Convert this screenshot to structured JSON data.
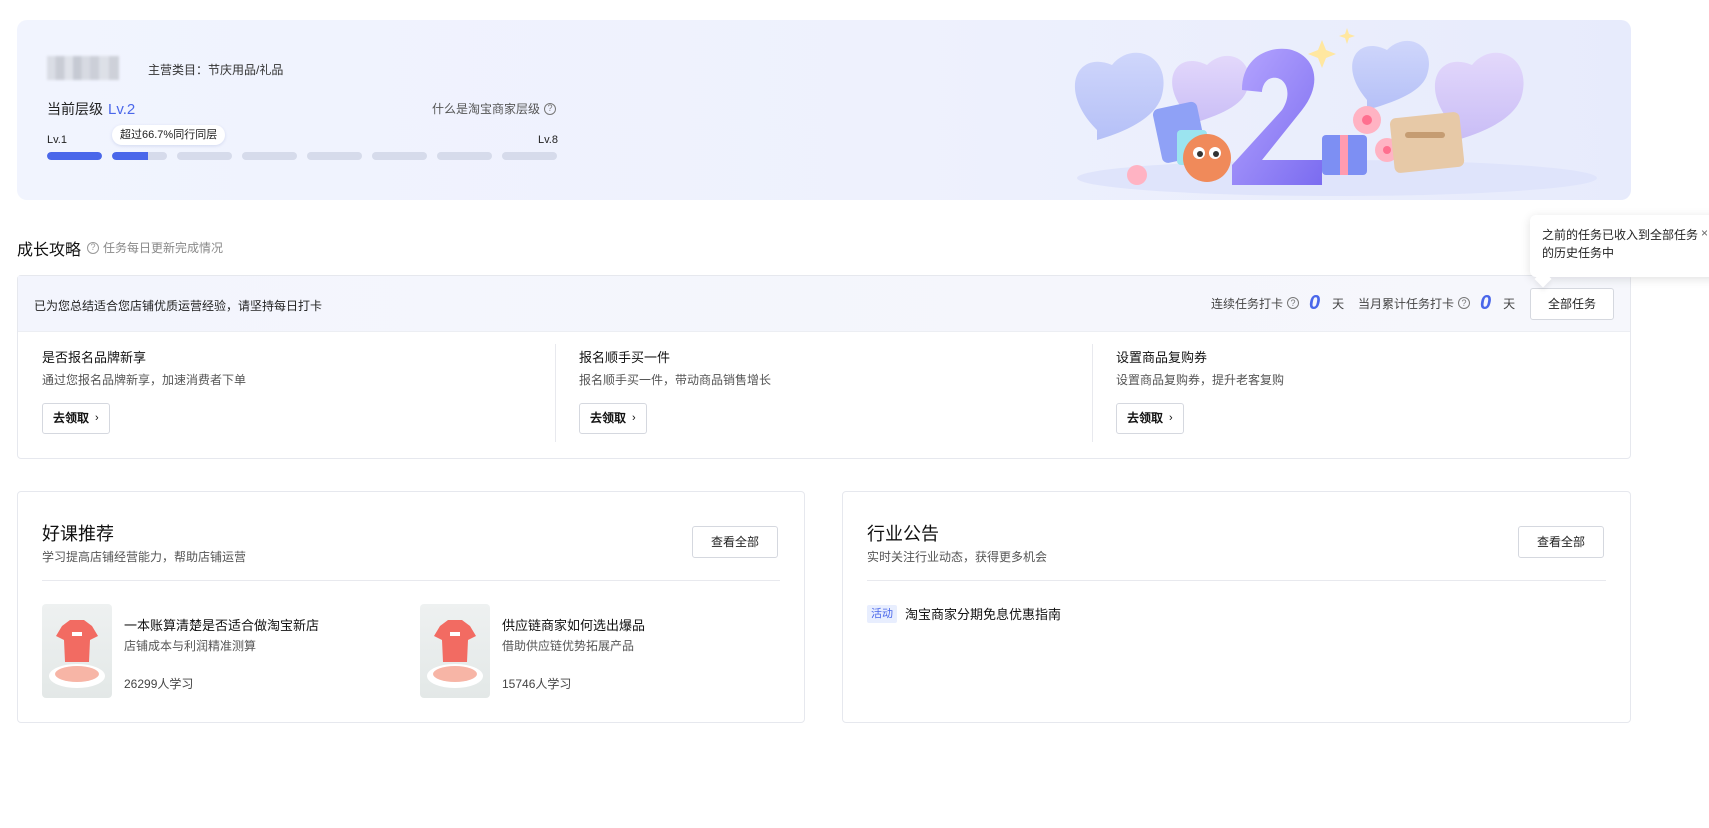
{
  "level": {
    "category": "主营类目：节庆用品/礼品",
    "current_label": "当前层级",
    "current_value": "Lv.2",
    "what_is_level": "什么是淘宝商家层级",
    "min_level": "Lv.1",
    "max_level": "Lv.8",
    "exceed_text": "超过66.7%同行同层",
    "progress": [
      1,
      0.65,
      0,
      0,
      0,
      0,
      0,
      0
    ]
  },
  "growth": {
    "title": "成长攻略",
    "subtitle": "任务每日更新完成情况",
    "tooltip": "之前的任务已收入到全部任务的历史任务中",
    "tooltip_close": "×",
    "header_text": "已为您总结适合您店铺优质运营经验，请坚持每日打卡",
    "streak_label": "连续任务打卡",
    "streak_value": "0",
    "month_label": "当月累计任务打卡",
    "month_value": "0",
    "unit": "天",
    "all_tasks_label": "全部任务",
    "tasks": [
      {
        "title": "是否报名品牌新享",
        "desc": "通过您报名品牌新享，加速消费者下单",
        "button": "去领取"
      },
      {
        "title": "报名顺手买一件",
        "desc": "报名顺手买一件，带动商品销售增长",
        "button": "去领取"
      },
      {
        "title": "设置商品复购券",
        "desc": "设置商品复购券，提升老客复购",
        "button": "去领取"
      }
    ]
  },
  "courses": {
    "title": "好课推荐",
    "subtitle": "学习提高店铺经营能力，帮助店铺运营",
    "view_all": "查看全部",
    "items": [
      {
        "title": "一本账算清楚是否适合做淘宝新店",
        "desc": "店铺成本与利润精准测算",
        "count": "26299人学习"
      },
      {
        "title": "供应链商家如何选出爆品",
        "desc": "借助供应链优势拓展产品",
        "count": "15746人学习"
      }
    ]
  },
  "announcements": {
    "title": "行业公告",
    "subtitle": "实时关注行业动态，获得更多机会",
    "view_all": "查看全部",
    "items": [
      {
        "tag": "活动",
        "title": "淘宝商家分期免息优惠指南"
      }
    ]
  },
  "colors": {
    "accent": "#4a67ea",
    "bar_empty": "#d6dbeb"
  }
}
